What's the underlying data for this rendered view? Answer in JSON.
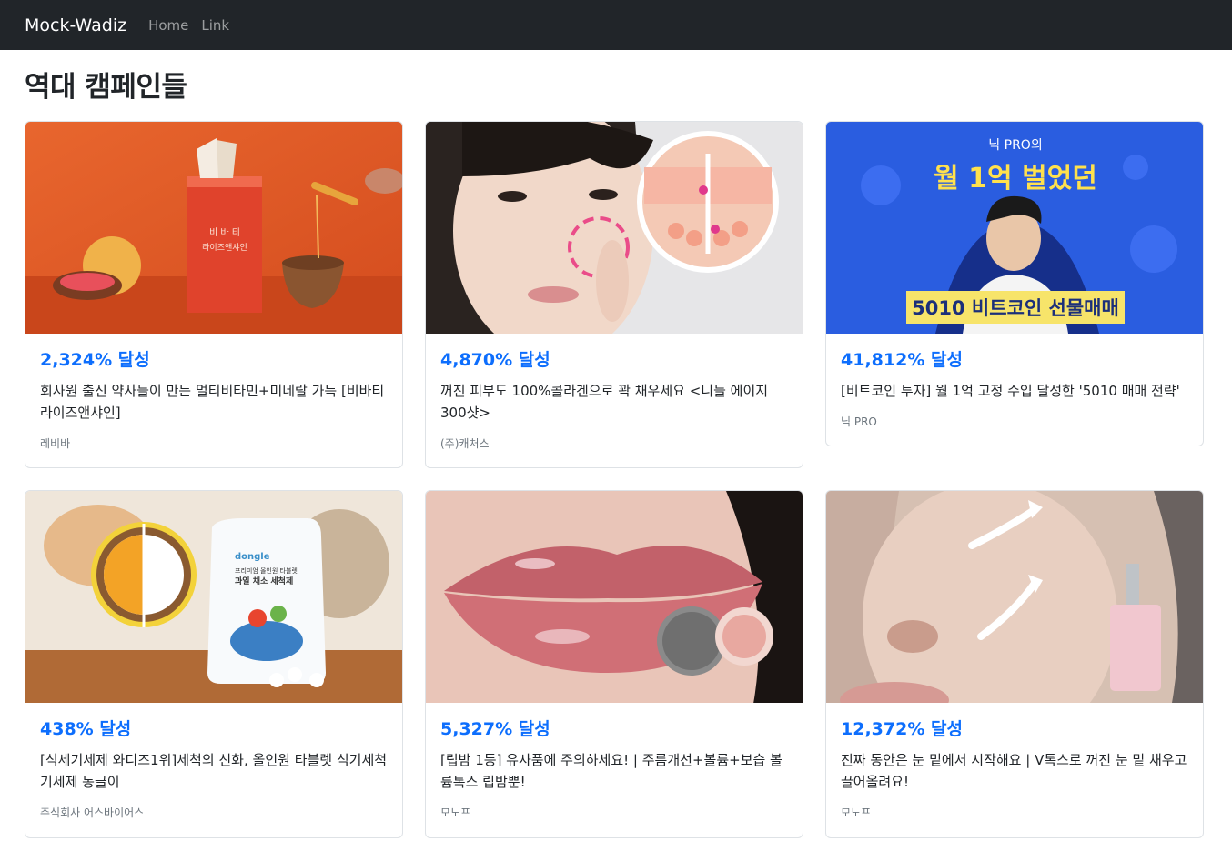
{
  "navbar": {
    "brand": "Mock-Wadiz",
    "links": [
      "Home",
      "Link"
    ]
  },
  "page": {
    "title": "역대 캠페인들"
  },
  "colors": {
    "navbar_bg": "#212529",
    "accent": "#0d6efd",
    "muted": "#6c757d"
  },
  "campaigns": [
    {
      "achievement": "2,324% 달성",
      "title": "회사원 출신 약사들이 만든 멀티비타민+미네랄 가득 [비바티 라이즈앤샤인]",
      "maker": "레비바",
      "image": "vitamin-box-orange",
      "image_text": [
        "비 바 티",
        "라이즈앤샤인"
      ]
    },
    {
      "achievement": "4,870% 달성",
      "title": "꺼진 피부도 100%콜라겐으로 꽉 채우세요 <니들 에이지 300샷>",
      "maker": "(주)캐처스",
      "image": "face-collagen-needle",
      "image_text": []
    },
    {
      "achievement": "41,812% 달성",
      "title": "[비트코인 투자] 월 1억 고정 수입 달성한 '5010 매매 전략'",
      "maker": "닉 PRO",
      "image": "bitcoin-lecture-banner",
      "image_text": [
        "닉 PRO의",
        "월 1억 벌었던",
        "5010 비트코인 선물매매"
      ]
    },
    {
      "achievement": "438% 달성",
      "title": "[식세기세제 와디즈1위]세척의 신화, 올인원 타블렛 식기세척기세제 동글이",
      "maker": "주식회사 어스바이어스",
      "image": "dishwasher-tablet-pouch",
      "image_text": [
        "dongle",
        "프리미엄 올인원 타블렛",
        "과일 채소 세척제"
      ]
    },
    {
      "achievement": "5,327% 달성",
      "title": "[립밤 1등] 유사품에 주의하세요! | 주름개선+볼륨+보습 볼륨톡스 립밤뿐!",
      "maker": "모노프",
      "image": "lip-balm-closeup",
      "image_text": []
    },
    {
      "achievement": "12,372% 달성",
      "title": "진짜 동안은 눈 밑에서 시작해요 | V톡스로 꺼진 눈 밑 채우고 끌어올려요!",
      "maker": "모노프",
      "image": "ampoule-face",
      "image_text": []
    }
  ]
}
